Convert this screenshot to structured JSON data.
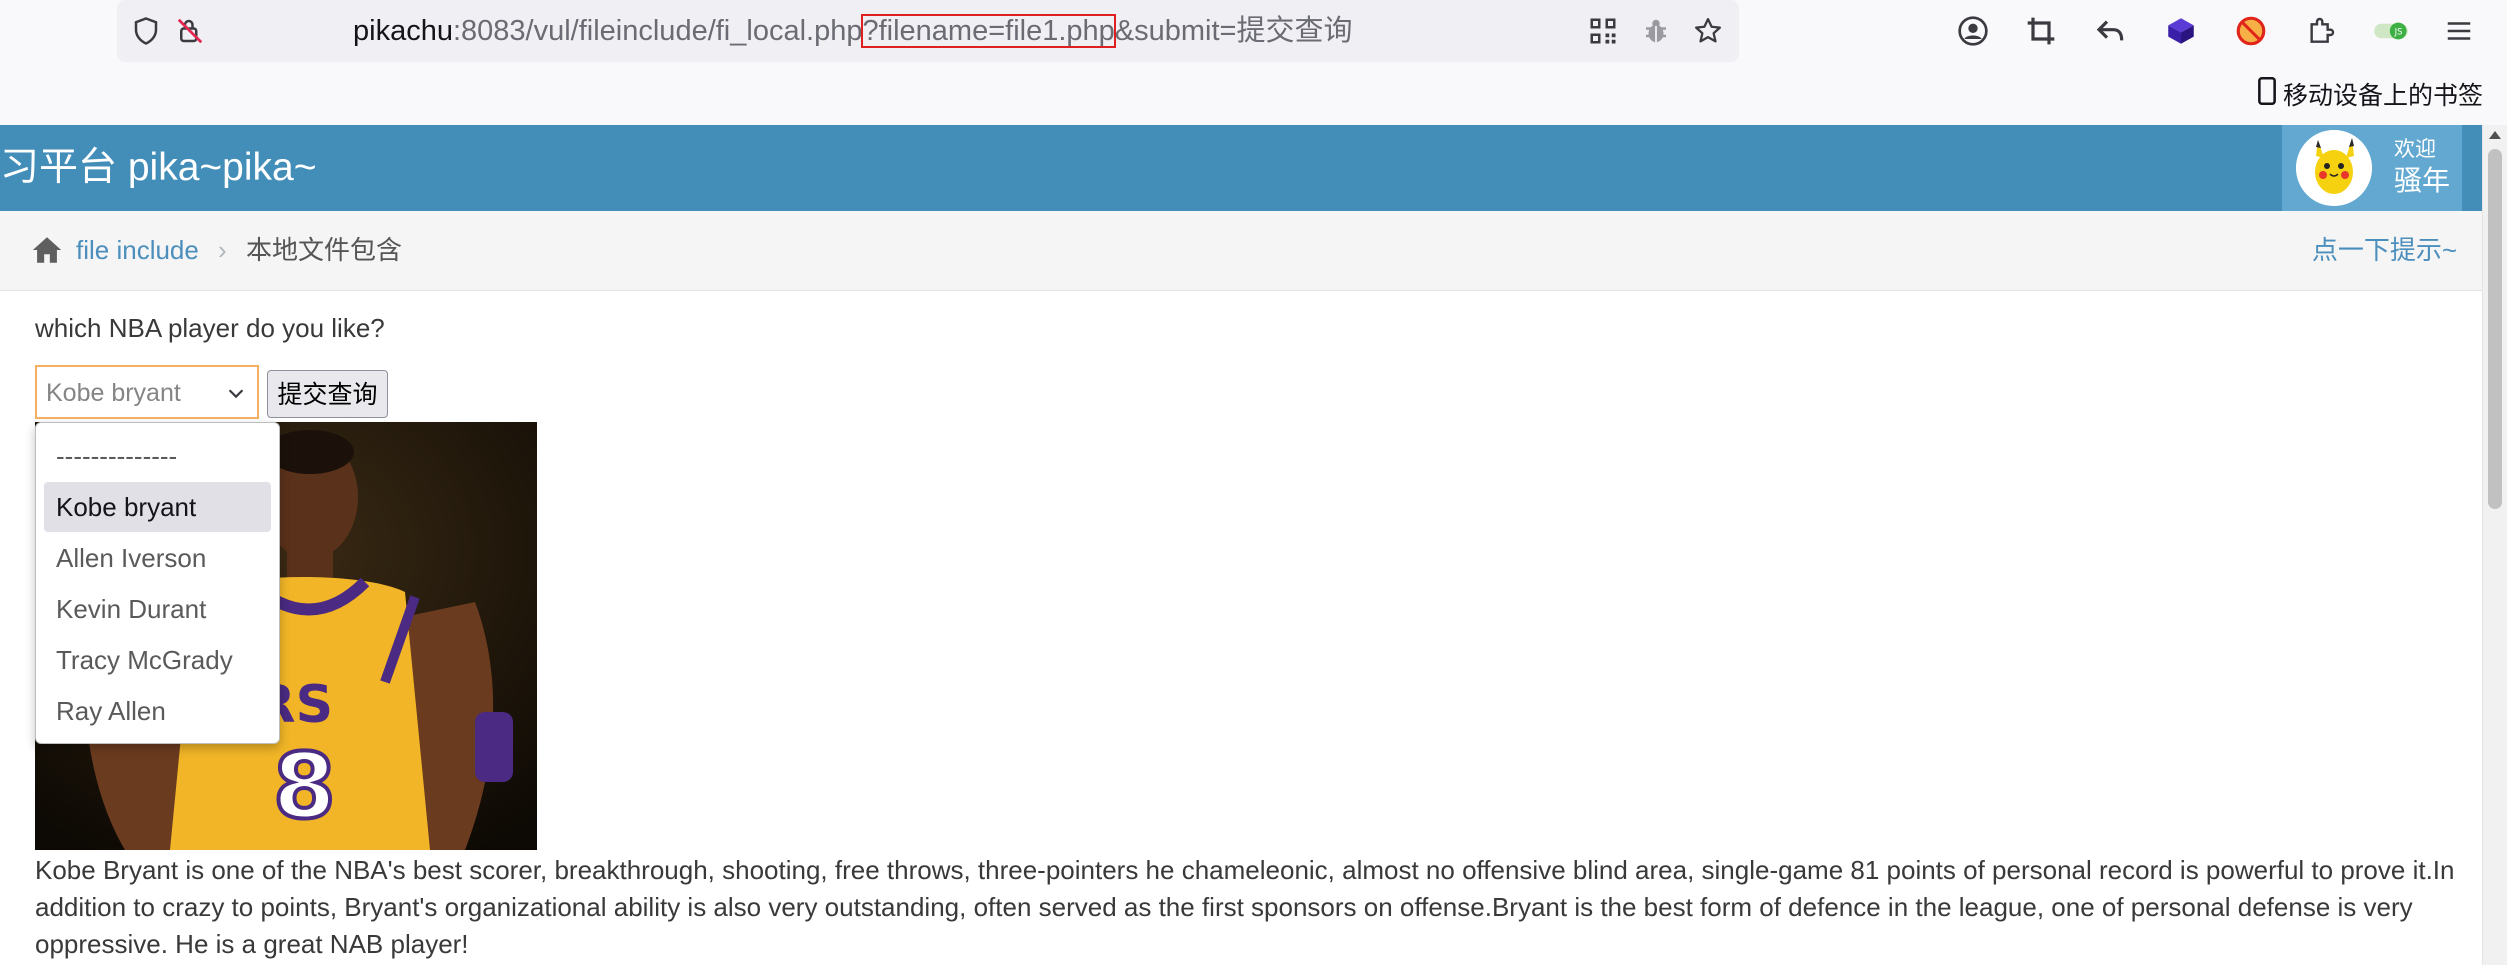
{
  "browser": {
    "url": {
      "host": "pikachu",
      "path": ":8083/vul/fileinclude/fi_local.php",
      "highlighted_query": "?filename=file1.php",
      "rest_query": "&submit=提交查询"
    },
    "bookmarks_label": "移动设备上的书签",
    "icons": [
      "shield-icon",
      "lock-warning-icon",
      "qr-code-icon",
      "bug-icon",
      "star-icon",
      "account-icon",
      "crop-icon",
      "undo-icon",
      "extension-cube-icon",
      "blocked-icon",
      "puzzle-icon",
      "toggle-icon",
      "menu-icon"
    ],
    "highlight_color": "#e02020"
  },
  "app": {
    "title": "习平台 pika~pika~",
    "header_color": "#438eb9",
    "user": {
      "welcome": "欢迎",
      "name": "骚年"
    }
  },
  "breadcrumbs": {
    "link": "file include",
    "separator": "›",
    "current": "本地文件包含",
    "hint": "点一下提示~"
  },
  "form": {
    "question": "which NBA player do you like?",
    "selected": "Kobe bryant",
    "submit_label": "提交查询",
    "options": [
      "--------------",
      "Kobe bryant",
      "Allen Iverson",
      "Kevin Durant",
      "Tracy McGrady",
      "Ray Allen"
    ]
  },
  "player": {
    "jersey_text": "ERS",
    "jersey_number": "8",
    "description": "Kobe Bryant is one of the NBA's best scorer, breakthrough, shooting, free throws, three-pointers he chameleonic, almost no offensive blind area, single-game 81 points of personal record is powerful to prove it.In addition to crazy to points, Bryant's organizational ability is also very outstanding, often served as the first sponsors on offense.Bryant is the best form of defence in the league, one of personal defense is very oppressive. He is a great NAB player!"
  }
}
